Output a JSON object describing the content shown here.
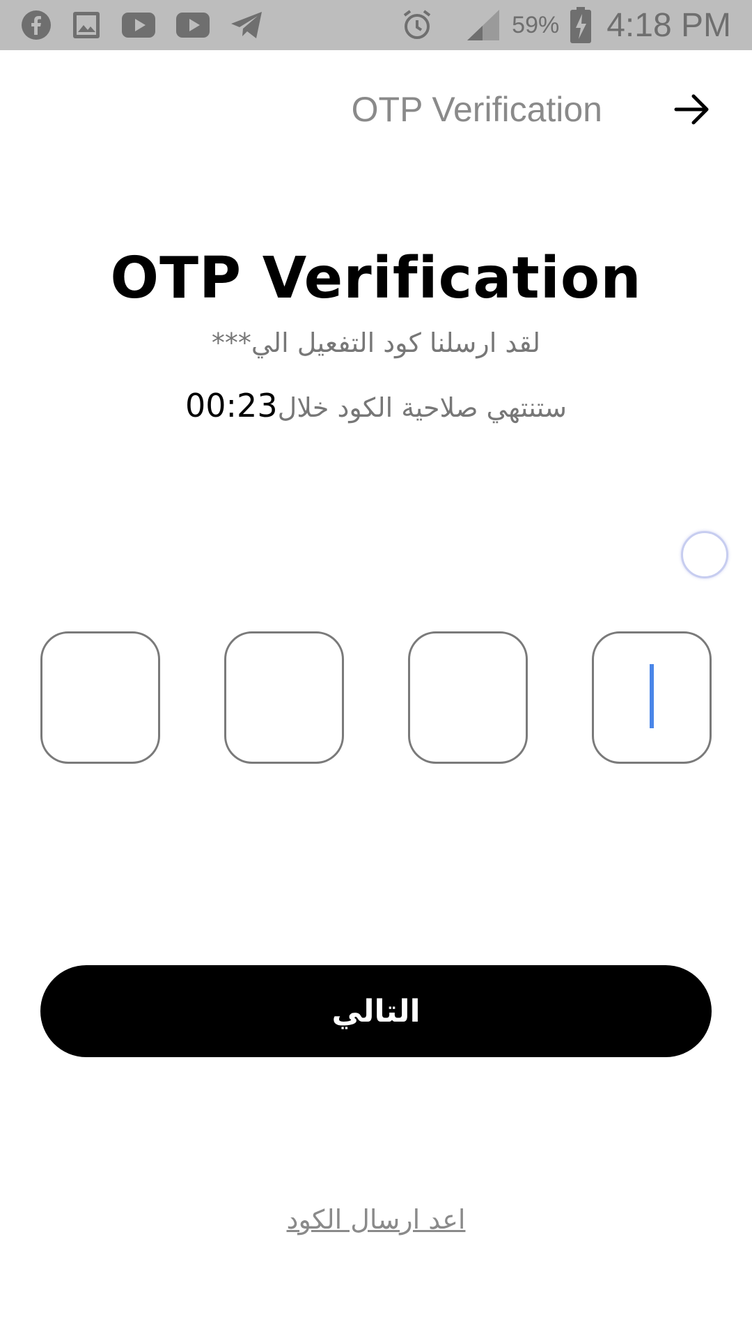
{
  "status_bar": {
    "icons": [
      "facebook-icon",
      "gallery-icon",
      "youtube-icon",
      "youtube-icon",
      "telegram-icon"
    ],
    "right_icons": [
      "alarm-icon",
      "signal-icon",
      "battery-charging-icon"
    ],
    "battery": "59%",
    "time": "4:18 PM"
  },
  "app_bar": {
    "title": "OTP Verification",
    "back_icon": "arrow-right-icon"
  },
  "main": {
    "heading": "OTP Verification",
    "sent_message": "لقد ارسلنا كود التفعيل الي***",
    "expiry_message": "ستنتهي صلاحية الكود خلال",
    "timer": "00:23"
  },
  "otp": {
    "boxes": [
      "",
      "",
      "",
      ""
    ],
    "active_index": 3
  },
  "actions": {
    "next_label": "التالي",
    "resend_label": "اعد ارسال الكود"
  },
  "colors": {
    "accent": "#000000",
    "caret": "#4a86e8",
    "status_bar_bg": "#bdbdbd"
  }
}
